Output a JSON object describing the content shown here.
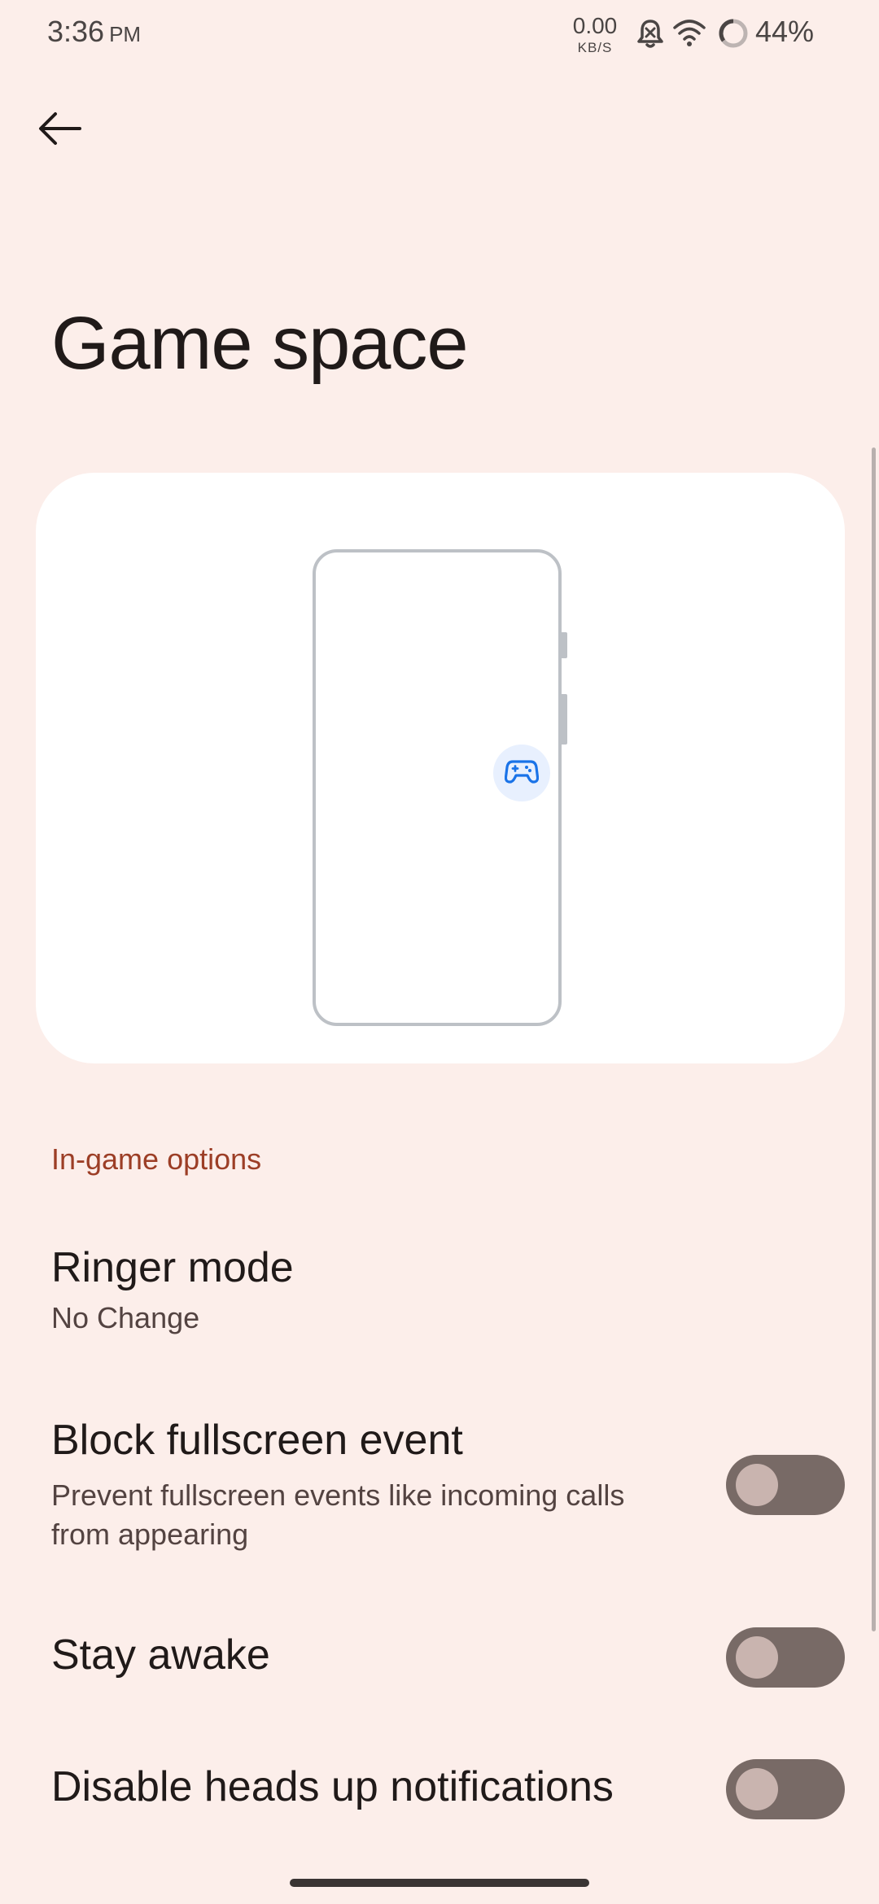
{
  "status_bar": {
    "time": "3:36",
    "ampm": "PM",
    "net_speed_value": "0.00",
    "net_speed_unit": "KB/S",
    "battery": "44%",
    "icons": [
      "bell-muted-icon",
      "wifi-icon",
      "battery-ring-icon"
    ]
  },
  "header": {
    "back_icon": "arrow-left-icon",
    "title": "Game space"
  },
  "illustration": {
    "icon": "gamepad-icon",
    "accent_color": "#1A73E8"
  },
  "section": {
    "title": "In-game options"
  },
  "preferences": [
    {
      "title": "Ringer mode",
      "summary": "No Change"
    },
    {
      "title": "Block fullscreen event",
      "summary": "Prevent fullscreen events like incoming calls from appearing",
      "toggle": false
    },
    {
      "title": "Stay awake",
      "toggle": false
    },
    {
      "title": "Disable heads up notifications",
      "toggle": false
    }
  ],
  "colors": {
    "background": "#FCEEEA",
    "section_header": "#9C3E26",
    "toggle_off_track": "#786A66"
  }
}
